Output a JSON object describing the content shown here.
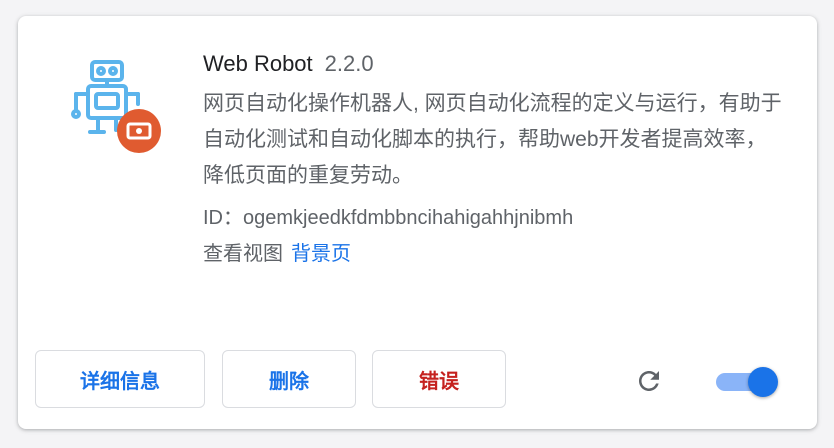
{
  "extension": {
    "name": "Web Robot",
    "version": "2.2.0",
    "description": "网页自动化操作机器人, 网页自动化流程的定义与运行，有助于自动化测试和自动化脚本的执行，帮助web开发者提高效率，降低页面的重复劳动。",
    "id_label": "ID：",
    "id_value": "ogemkjeedkfdmbbncihahigahhjnibmh",
    "views_label": "查看视图",
    "views_link": "背景页",
    "icon": "robot-icon",
    "badge_icon": "recording-badge-icon",
    "enabled": true
  },
  "buttons": {
    "details": "详细信息",
    "remove": "删除",
    "errors": "错误"
  },
  "controls": {
    "reload_icon": "reload-icon",
    "toggle_icon": "enable-toggle"
  },
  "colors": {
    "accent": "#1a73e8",
    "error": "#c5221f",
    "robot_blue": "#5bb4ec",
    "badge_orange": "#e05b30",
    "toggle_track": "#8ab4f8"
  }
}
